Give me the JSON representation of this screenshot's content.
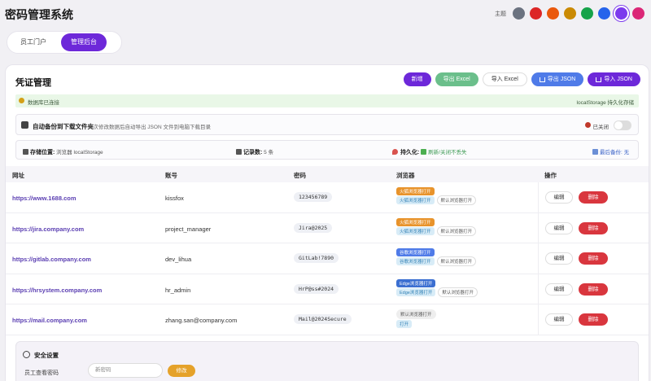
{
  "app": {
    "title": "密码管理系统"
  },
  "theme": {
    "label": "主题",
    "colors": [
      "#6b7280",
      "#dc2626",
      "#ea580c",
      "#ca8a04",
      "#16a34a",
      "#2563eb",
      "#7c3aed",
      "#db2777"
    ],
    "active_color": "#7c3aed"
  },
  "nav": {
    "tabs": [
      {
        "label": "员工门户"
      },
      {
        "label": "管理后台"
      }
    ],
    "active_tab": "管理后台"
  },
  "panel": {
    "title": "凭证管理",
    "buttons": {
      "new": "新增",
      "export_excel": "导出 Excel",
      "import_excel": "导入 Excel",
      "export_json": "导出 JSON",
      "import_json": "导入 JSON"
    }
  },
  "status": {
    "text": "数据库已连接",
    "storage": "localStorage 持久化存储"
  },
  "backup": {
    "title": "自动备份到下载文件夹",
    "desc": "每次修改数据后自动导出 JSON 文件到电脑下载目录",
    "state": "已关闭"
  },
  "info": {
    "location_label": "存储位置:",
    "location_value": "浏览器 localStorage",
    "count_label": "记录数:",
    "count_value": "5 条",
    "persist_label": "持久化:",
    "persist_value": "刷新/关闭不丢失",
    "last_backup_label": "最后备份:",
    "last_backup_value": "无"
  },
  "table": {
    "headers": {
      "url": "网址",
      "account": "账号",
      "password": "密码",
      "browser": "浏览器",
      "actions": "操作"
    },
    "edit_label": "编辑",
    "delete_label": "删除",
    "default_browser_label": "默认浏览器打开",
    "rows": [
      {
        "url": "https://www.1688.com",
        "account": "kissfox",
        "password": "123456789",
        "browser_primary": "火狐浏览器打开",
        "browser_secondary": "火狐浏览器打开",
        "primary_color": "#e8932b",
        "secondary_bg": "#d8ecf7",
        "secondary_color": "#2f7fb5"
      },
      {
        "url": "https://jira.company.com",
        "account": "project_manager",
        "password": "Jira@2025",
        "browser_primary": "火狐浏览器打开",
        "browser_secondary": "火狐浏览器打开",
        "primary_color": "#e8932b",
        "secondary_bg": "#d8ecf7",
        "secondary_color": "#2f7fb5"
      },
      {
        "url": "https://gitlab.company.com",
        "account": "dev_lihua",
        "password": "GitLab!7890",
        "browser_primary": "谷歌浏览器打开",
        "browser_secondary": "谷歌浏览器打开",
        "primary_color": "#4f7be8",
        "secondary_bg": "#d8ecf7",
        "secondary_color": "#2f7fb5"
      },
      {
        "url": "https://hrsystem.company.com",
        "account": "hr_admin",
        "password": "HrP@ss#2024",
        "browser_primary": "Edge浏览器打开",
        "browser_secondary": "Edge浏览器打开",
        "primary_color": "#3b6fd1",
        "secondary_bg": "#d8ecf7",
        "secondary_color": "#2f7fb5"
      },
      {
        "url": "https://mail.company.com",
        "account": "zhang.san@company.com",
        "password": "Mail@2024Secure",
        "browser_primary": "",
        "browser_secondary": "打开",
        "primary_color": "",
        "secondary_bg": "#d8ecf7",
        "secondary_color": "#2f7fb5"
      }
    ]
  },
  "security": {
    "title": "安全设置",
    "label": "员工查看密码",
    "placeholder": "新密码",
    "button": "修改"
  }
}
